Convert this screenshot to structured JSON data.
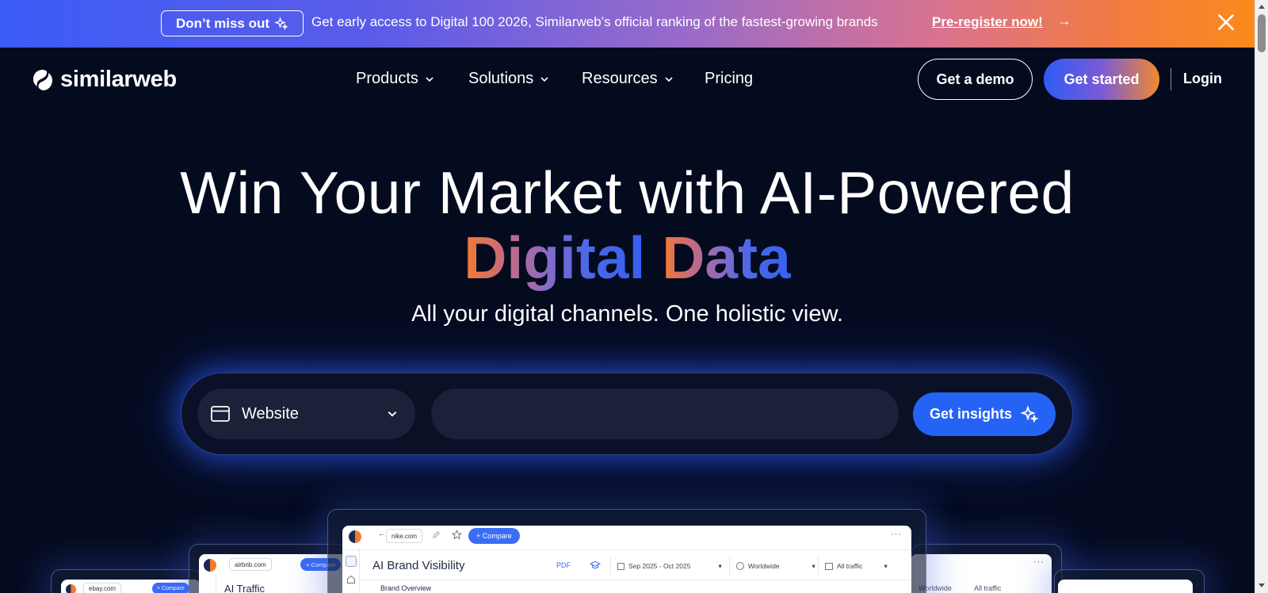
{
  "banner": {
    "pill_label": "Don’t miss out",
    "text": "Get early access to Digital 100 2026, Similarweb’s official ranking of the fastest-growing brands",
    "link": "Pre-register now!",
    "arrow": "→",
    "icons": [
      "sparkle-icon",
      "arrow-right-icon",
      "close-icon"
    ]
  },
  "brand": {
    "name": "similarweb"
  },
  "nav": {
    "items": [
      {
        "label": "Products",
        "has_dropdown": true
      },
      {
        "label": "Solutions",
        "has_dropdown": true
      },
      {
        "label": "Resources",
        "has_dropdown": true
      },
      {
        "label": "Pricing",
        "has_dropdown": false
      }
    ],
    "demo_label": "Get a demo",
    "start_label": "Get started",
    "login_label": "Login"
  },
  "hero": {
    "line1": "Win Your Market with AI-Powered",
    "line2_a": "Digital",
    "line2_b": "Data",
    "subtitle": "All your digital channels. One holistic view."
  },
  "search": {
    "type_selected": "Website",
    "input_value": "",
    "input_placeholder": "",
    "button_label": "Get insights"
  },
  "previews": {
    "center": {
      "domain": "nike.com",
      "compare_label": "+ Compare",
      "title": "AI Brand Visibility",
      "pdf_label": "PDF",
      "date_range": "Sep 2025 - Oct 2025",
      "region": "Worldwide",
      "traffic": "All traffic",
      "section": "Brand Overview"
    },
    "left": {
      "domain": "airbnb.com",
      "compare_label": "+ Compare",
      "title": "AI Traffic"
    },
    "far_left": {
      "domain": "ebay.com",
      "compare_label": "+ Compare"
    },
    "right": {
      "region": "Worldwide",
      "traffic": "All traffic"
    }
  },
  "colors": {
    "background": "#050b1f",
    "accent_blue": "#2563f5",
    "accent_orange": "#f47a30"
  }
}
